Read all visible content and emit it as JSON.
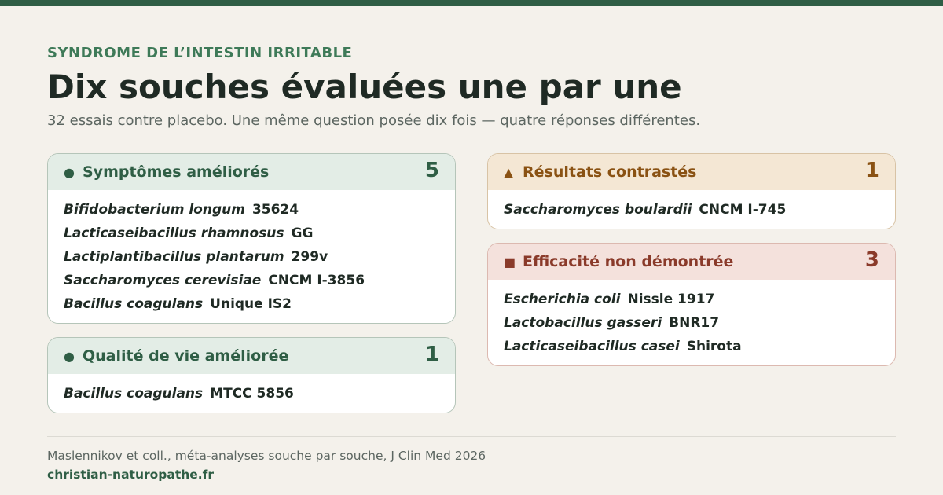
{
  "header": {
    "eyebrow": "SYNDROME DE L’INTESTIN IRRITABLE",
    "title": "Dix souches évaluées une par une",
    "subtitle": "32 essais contre placebo. Une même question posée dix fois — quatre réponses différentes."
  },
  "cards": {
    "symptomes": {
      "marker": "●",
      "label": "Symptômes améliorés",
      "count": "5",
      "color": "#2f5e45",
      "strains": [
        {
          "species": "Bifidobacterium longum",
          "strain": "35624"
        },
        {
          "species": "Lacticaseibacillus rhamnosus",
          "strain": "GG"
        },
        {
          "species": "Lactiplantibacillus plantarum",
          "strain": "299v"
        },
        {
          "species": "Saccharomyces cerevisiae",
          "strain": "CNCM I-3856"
        },
        {
          "species": "Bacillus coagulans",
          "strain": "Unique IS2"
        }
      ]
    },
    "qualite": {
      "marker": "●",
      "label": "Qualité de vie améliorée",
      "count": "1",
      "color": "#2f5e45",
      "strains": [
        {
          "species": "Bacillus coagulans",
          "strain": "MTCC 5856"
        }
      ]
    },
    "contrastes": {
      "marker": "▲",
      "label": "Résultats contrastés",
      "count": "1",
      "color": "#8a5213",
      "strains": [
        {
          "species": "Saccharomyces boulardii",
          "strain": "CNCM I-745"
        }
      ]
    },
    "non_demontree": {
      "marker": "■",
      "label": "Efficacité non démontrée",
      "count": "3",
      "color": "#8a3a2a",
      "strains": [
        {
          "species": "Escherichia coli",
          "strain": "Nissle 1917"
        },
        {
          "species": "Lactobacillus gasseri",
          "strain": "BNR17"
        },
        {
          "species": "Lacticaseibacillus casei",
          "strain": "Shirota"
        }
      ]
    }
  },
  "footer": {
    "source": "Maslennikov et coll., méta-analyses souche par souche, J Clin Med 2026",
    "site": "christian-naturopathe.fr"
  }
}
